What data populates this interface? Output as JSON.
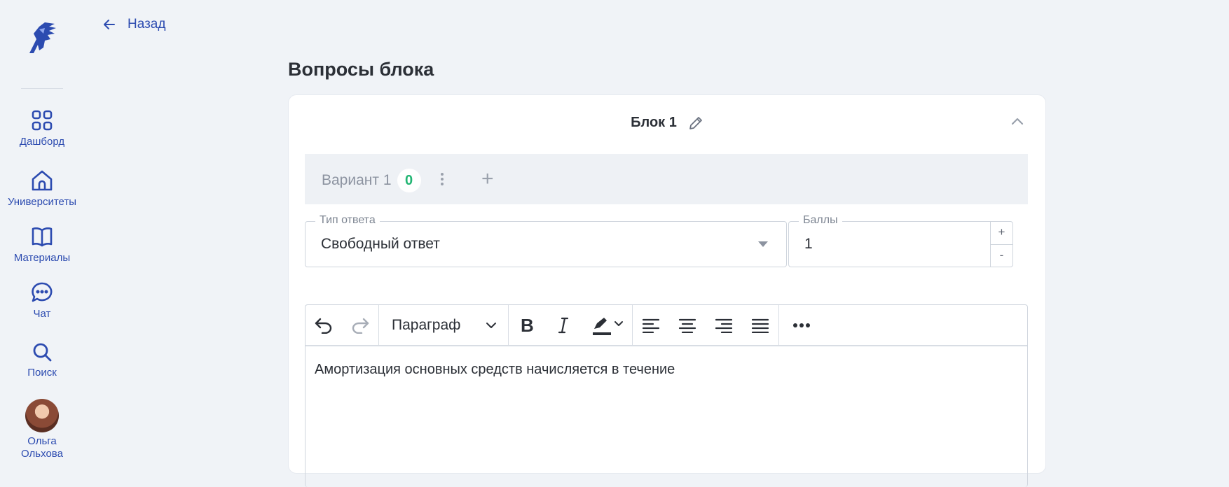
{
  "sidebar": {
    "items": [
      {
        "label": "Дашборд",
        "icon": "dashboard-grid-icon"
      },
      {
        "label": "Университеты",
        "icon": "university-icon"
      },
      {
        "label": "Материалы",
        "icon": "book-icon"
      },
      {
        "label": "Чат",
        "icon": "chat-icon"
      },
      {
        "label": "Поиск",
        "icon": "search-icon"
      }
    ],
    "user": {
      "first_name": "Ольга",
      "last_name": "Ольхова"
    }
  },
  "back": {
    "label": "Назад"
  },
  "page": {
    "title": "Вопросы блока"
  },
  "block": {
    "title": "Блок 1"
  },
  "variants": [
    {
      "label": "Вариант 1",
      "count": "0"
    }
  ],
  "add_variant": "+",
  "answer_type": {
    "label": "Тип ответа",
    "value": "Свободный ответ"
  },
  "points": {
    "label": "Баллы",
    "value": "1",
    "plus": "+",
    "minus": "-"
  },
  "editor": {
    "format": "Параграф",
    "content": "Амортизация основных средств начисляется в течение"
  },
  "colors": {
    "accent": "#2c4bb0",
    "badge": "#22b573",
    "background": "#f0f3f7"
  }
}
